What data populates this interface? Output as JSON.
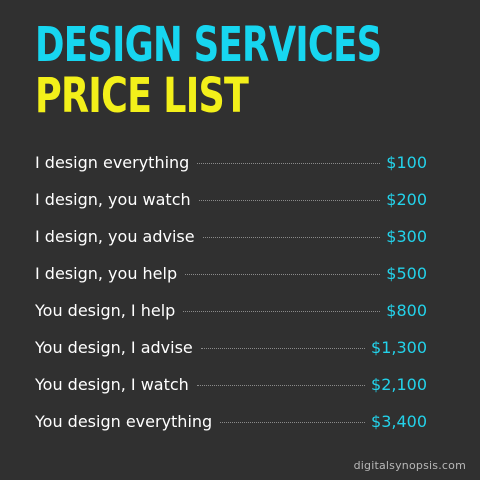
{
  "header": {
    "title_line1": "DESIGN SERVICES",
    "title_line2": "PRICE LIST"
  },
  "price_list": [
    {
      "service": "I design everything",
      "price": "$100"
    },
    {
      "service": "I design, you watch",
      "price": "$200"
    },
    {
      "service": "I design, you advise",
      "price": "$300"
    },
    {
      "service": "I design, you help",
      "price": "$500"
    },
    {
      "service": "You design, I help",
      "price": "$800"
    },
    {
      "service": "You design, I advise",
      "price": "$1,300"
    },
    {
      "service": "You design, I watch",
      "price": "$2,100"
    },
    {
      "service": "You design everything",
      "price": "$3,400"
    }
  ],
  "footer": {
    "credit": "digitalsynopsis.com"
  },
  "colors": {
    "background": "#303030",
    "title_primary": "#17d6f0",
    "title_secondary": "#f3f01a",
    "price": "#23d2ea",
    "text": "#ffffff"
  }
}
